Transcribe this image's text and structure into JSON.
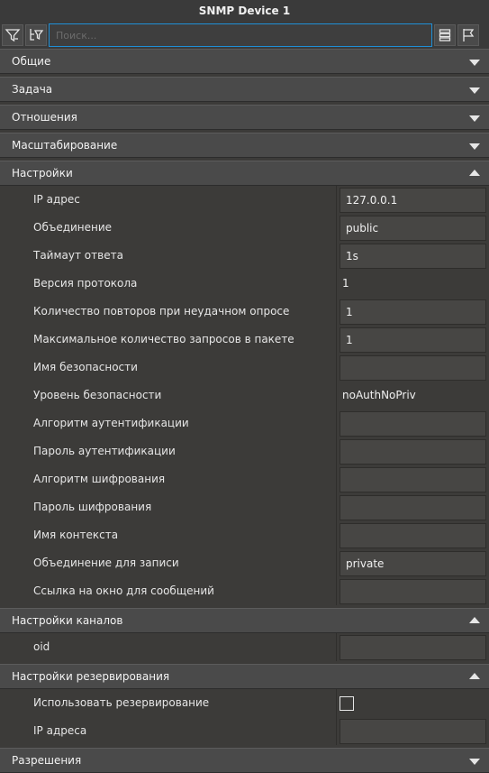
{
  "window": {
    "title": "SNMP Device 1"
  },
  "toolbar": {
    "filter_icon": "filter-icon",
    "tree_icon": "tree-filter-icon",
    "list_icon": "list-view-icon",
    "flag_icon": "flag-icon",
    "search_placeholder": "Поиск...",
    "search_value": ""
  },
  "sections": {
    "general": {
      "label": "Общие",
      "expanded": false
    },
    "task": {
      "label": "Задача",
      "expanded": false
    },
    "relations": {
      "label": "Отношения",
      "expanded": false
    },
    "scaling": {
      "label": "Масштабирование",
      "expanded": false
    },
    "settings": {
      "label": "Настройки",
      "expanded": true
    },
    "channel_settings": {
      "label": "Настройки каналов",
      "expanded": true
    },
    "redundancy": {
      "label": "Настройки резервирования",
      "expanded": true
    },
    "permissions": {
      "label": "Разрешения",
      "expanded": false
    }
  },
  "settings": [
    {
      "label": "IP адрес",
      "value": "127.0.0.1",
      "kind": "field"
    },
    {
      "label": "Объединение",
      "value": "public",
      "kind": "field"
    },
    {
      "label": "Таймаут ответа",
      "value": "1s",
      "kind": "field"
    },
    {
      "label": "Версия протокола",
      "value": "1",
      "kind": "plain"
    },
    {
      "label": "Количество повторов при неудачном опросе",
      "value": "1",
      "kind": "field"
    },
    {
      "label": "Максимальное количество запросов в пакете",
      "value": "1",
      "kind": "field"
    },
    {
      "label": "Имя безопасности",
      "value": "",
      "kind": "field"
    },
    {
      "label": "Уровень безопасности",
      "value": "noAuthNoPriv",
      "kind": "plain"
    },
    {
      "label": "Алгоритм аутентификации",
      "value": "",
      "kind": "field"
    },
    {
      "label": "Пароль аутентификации",
      "value": "",
      "kind": "field"
    },
    {
      "label": "Алгоритм шифрования",
      "value": "",
      "kind": "field"
    },
    {
      "label": "Пароль шифрования",
      "value": "",
      "kind": "field"
    },
    {
      "label": "Имя контекста",
      "value": "",
      "kind": "field"
    },
    {
      "label": "Объединение для записи",
      "value": "private",
      "kind": "field"
    },
    {
      "label": "Ссылка на окно для сообщений",
      "value": "",
      "kind": "field"
    }
  ],
  "channel_settings": [
    {
      "label": "oid",
      "value": "",
      "kind": "field"
    }
  ],
  "redundancy": [
    {
      "label": "Использовать резервирование",
      "checked": false,
      "kind": "checkbox"
    },
    {
      "label": "IP адреса",
      "value": "",
      "kind": "field"
    }
  ]
}
